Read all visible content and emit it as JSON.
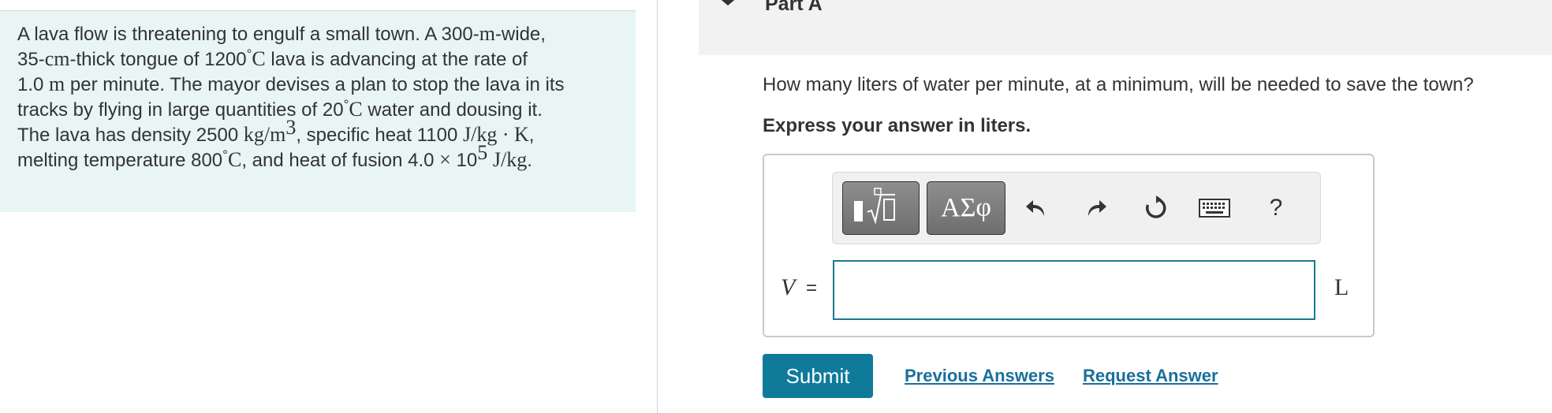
{
  "problem": {
    "line1": {
      "t1": "A lava flow is threatening to engulf a small town. A 300-",
      "m1": "m",
      "t2": "-wide,"
    },
    "line2": {
      "t1": "35-",
      "m1": "cm",
      "t2": "-thick tongue of 1200",
      "deg": "°",
      "m2": "C",
      "t3": " lava is advancing at the rate of"
    },
    "line3": {
      "t1": "1.0 ",
      "m1": "m",
      "t2": " per minute. The mayor devises a plan to stop the lava in its"
    },
    "line4": {
      "t1": "tracks by flying in large quantities of 20",
      "deg": "°",
      "m1": "C",
      "t2": " water and dousing it."
    },
    "line5": {
      "t1": "The lava has density 2500 ",
      "m1": "kg/m",
      "sup": "3",
      "t2": ", specific heat 1100 ",
      "m2": "J/kg · K",
      "t3": ","
    },
    "line6": {
      "t1": "melting temperature 800",
      "deg": "°",
      "m1": "C",
      "t2": ", and heat of fusion 4.0 ",
      "times": "×",
      "t3": " 10",
      "sup": "5",
      "t4": " ",
      "m2": "J/kg",
      "t5": "."
    }
  },
  "part": {
    "title": "Part A"
  },
  "question": "How many liters of water per minute, at a minimum, will be needed to save the town?",
  "instruction": "Express your answer in liters.",
  "toolbar": {
    "greek_label": "ΑΣφ",
    "help_label": "?",
    "icons": [
      "templates-icon",
      "greek-symbols-icon",
      "undo-icon",
      "redo-icon",
      "reset-icon",
      "keyboard-icon",
      "help-icon"
    ]
  },
  "answer": {
    "variable": "V",
    "equals": "=",
    "value": "",
    "unit": "L"
  },
  "actions": {
    "submit": "Submit",
    "previous_answers": "Previous Answers",
    "request_answer": "Request Answer"
  },
  "colors": {
    "accent": "#0f7a9a",
    "link": "#1a6f9a",
    "problem_bg": "#e8f5f4",
    "input_border": "#1a7a8a",
    "header_bg": "#f2f2f2"
  }
}
